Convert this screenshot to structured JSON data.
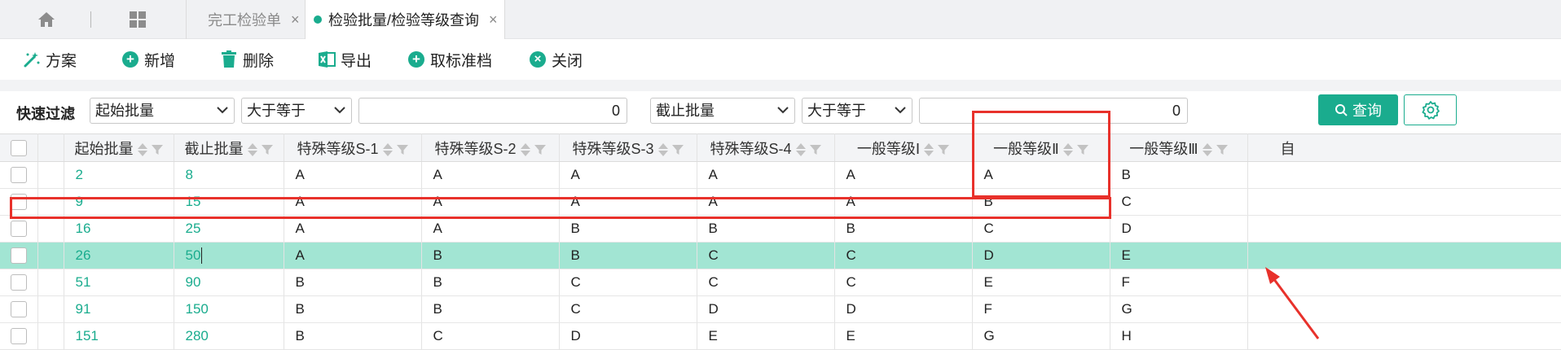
{
  "tabs": {
    "items": [
      {
        "label": "完工检验单",
        "close": "×"
      },
      {
        "label": "检验批量/检验等级查询",
        "close": "×"
      }
    ]
  },
  "toolbar": {
    "scheme": "方案",
    "add": "新增",
    "delete": "删除",
    "export": "导出",
    "unstandard": "取标准档",
    "close": "关闭"
  },
  "filter": {
    "label": "快速过滤",
    "field1": "起始批量",
    "op1": "大于等于",
    "value1": "0",
    "field2": "截止批量",
    "op2": "大于等于",
    "value2": "0",
    "query": "查询"
  },
  "table": {
    "headers": [
      "起始批量",
      "截止批量",
      "特殊等级S-1",
      "特殊等级S-2",
      "特殊等级S-3",
      "特殊等级S-4",
      "一般等级Ⅰ",
      "一般等级Ⅱ",
      "一般等级Ⅲ",
      "自"
    ],
    "rows": [
      [
        "2",
        "8",
        "A",
        "A",
        "A",
        "A",
        "A",
        "A",
        "B"
      ],
      [
        "9",
        "15",
        "A",
        "A",
        "A",
        "A",
        "A",
        "B",
        "C"
      ],
      [
        "16",
        "25",
        "A",
        "A",
        "B",
        "B",
        "B",
        "C",
        "D"
      ],
      [
        "26",
        "50",
        "A",
        "B",
        "B",
        "C",
        "C",
        "D",
        "E"
      ],
      [
        "51",
        "90",
        "B",
        "B",
        "C",
        "C",
        "C",
        "E",
        "F"
      ],
      [
        "91",
        "150",
        "B",
        "B",
        "C",
        "D",
        "D",
        "F",
        "G"
      ],
      [
        "151",
        "280",
        "B",
        "C",
        "D",
        "E",
        "E",
        "G",
        "H"
      ]
    ],
    "selected_row": 3
  },
  "colors": {
    "accent": "#1aac8e",
    "selected_row": "#a2e5d3",
    "annotation": "#e8312b"
  }
}
